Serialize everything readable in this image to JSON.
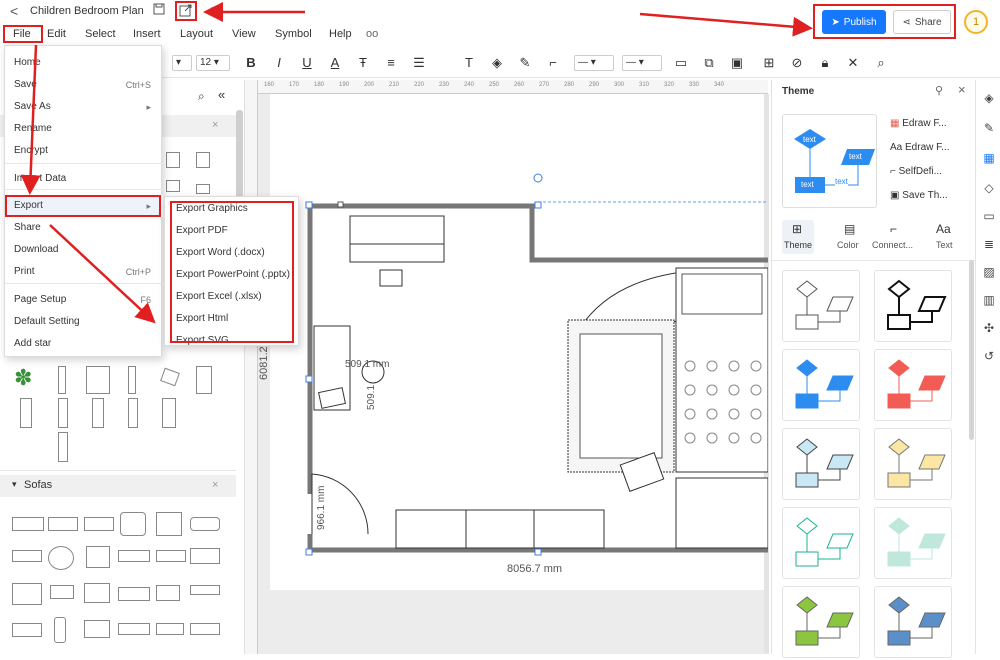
{
  "title_bar": {
    "back_glyph": "<",
    "doc_title": "Children Bedroom Plan",
    "publish_label": "Publish",
    "share_label": "Share",
    "avatar_text": "1"
  },
  "menu": [
    "File",
    "Edit",
    "Select",
    "Insert",
    "Layout",
    "View",
    "Symbol",
    "Help"
  ],
  "toolbar": {
    "font_size": "12",
    "icons": [
      "bold-icon",
      "italic-icon",
      "underline-icon",
      "font-color-icon",
      "text-style-icon",
      "align-icon",
      "line-spacing-icon",
      "text-box-icon",
      "fill-icon",
      "line-color-icon",
      "connector-icon",
      "line-style-icon",
      "line-weight-icon",
      "arrange-icon",
      "group-icon",
      "size-icon",
      "distribute-icon",
      "replace-icon",
      "lock-icon",
      "tools-icon",
      "search-icon"
    ]
  },
  "file_menu": {
    "items": [
      {
        "label": "Home",
        "shortcut": ""
      },
      {
        "label": "Save",
        "shortcut": "Ctrl+S"
      },
      {
        "label": "Save As",
        "shortcut": "▸"
      },
      {
        "label": "Rename",
        "shortcut": ""
      },
      {
        "label": "Encrypt",
        "shortcut": ""
      },
      {
        "label": "Import Data",
        "shortcut": ""
      },
      {
        "label": "Export",
        "shortcut": "▸"
      },
      {
        "label": "Share",
        "shortcut": ""
      },
      {
        "label": "Download",
        "shortcut": ""
      },
      {
        "label": "Print",
        "shortcut": "Ctrl+P"
      },
      {
        "label": "Page Setup",
        "shortcut": "F6"
      },
      {
        "label": "Default Setting",
        "shortcut": ""
      },
      {
        "label": "Add star",
        "shortcut": ""
      }
    ]
  },
  "export_submenu": [
    "Export Graphics",
    "Export PDF",
    "Export Word (.docx)",
    "Export PowerPoint (.pptx)",
    "Export Excel (.xlsx)",
    "Export Html",
    "Export SVG"
  ],
  "library": {
    "sofas_title": "Sofas",
    "close_glyph": "×",
    "collapse_glyph": "▾"
  },
  "ruler_marks": [
    "160",
    "170",
    "180",
    "190",
    "200",
    "210",
    "220",
    "230",
    "240",
    "250",
    "260",
    "270",
    "280",
    "290",
    "300",
    "310",
    "320",
    "330",
    "340"
  ],
  "canvas": {
    "dim_bottom": "8056.7 mm",
    "dim_left": "6081.2 mm",
    "dim_small_a": "509.1 mm",
    "dim_small_b": "509.1",
    "dim_door": "966.1 mm"
  },
  "theme_panel": {
    "title": "Theme",
    "options": [
      "Edraw F...",
      "Edraw F...",
      "SelfDefi...",
      "Save Th..."
    ],
    "preview_labels": [
      "text",
      "text",
      "text",
      "text"
    ],
    "tabs": [
      "Theme",
      "Color",
      "Connect...",
      "Text"
    ]
  },
  "colors": {
    "publish_blue": "#1677ff",
    "annotation_red": "#e02020",
    "theme_blue": "#2d8cf0",
    "theme_red": "#f25c54",
    "theme_lightblue": "#c9e8f5",
    "theme_yellow": "#fbe7a3",
    "theme_green": "#19b394",
    "theme_mint": "#bfe7dc",
    "theme_lime": "#8cc63f",
    "theme_steel": "#5a8fc9"
  }
}
